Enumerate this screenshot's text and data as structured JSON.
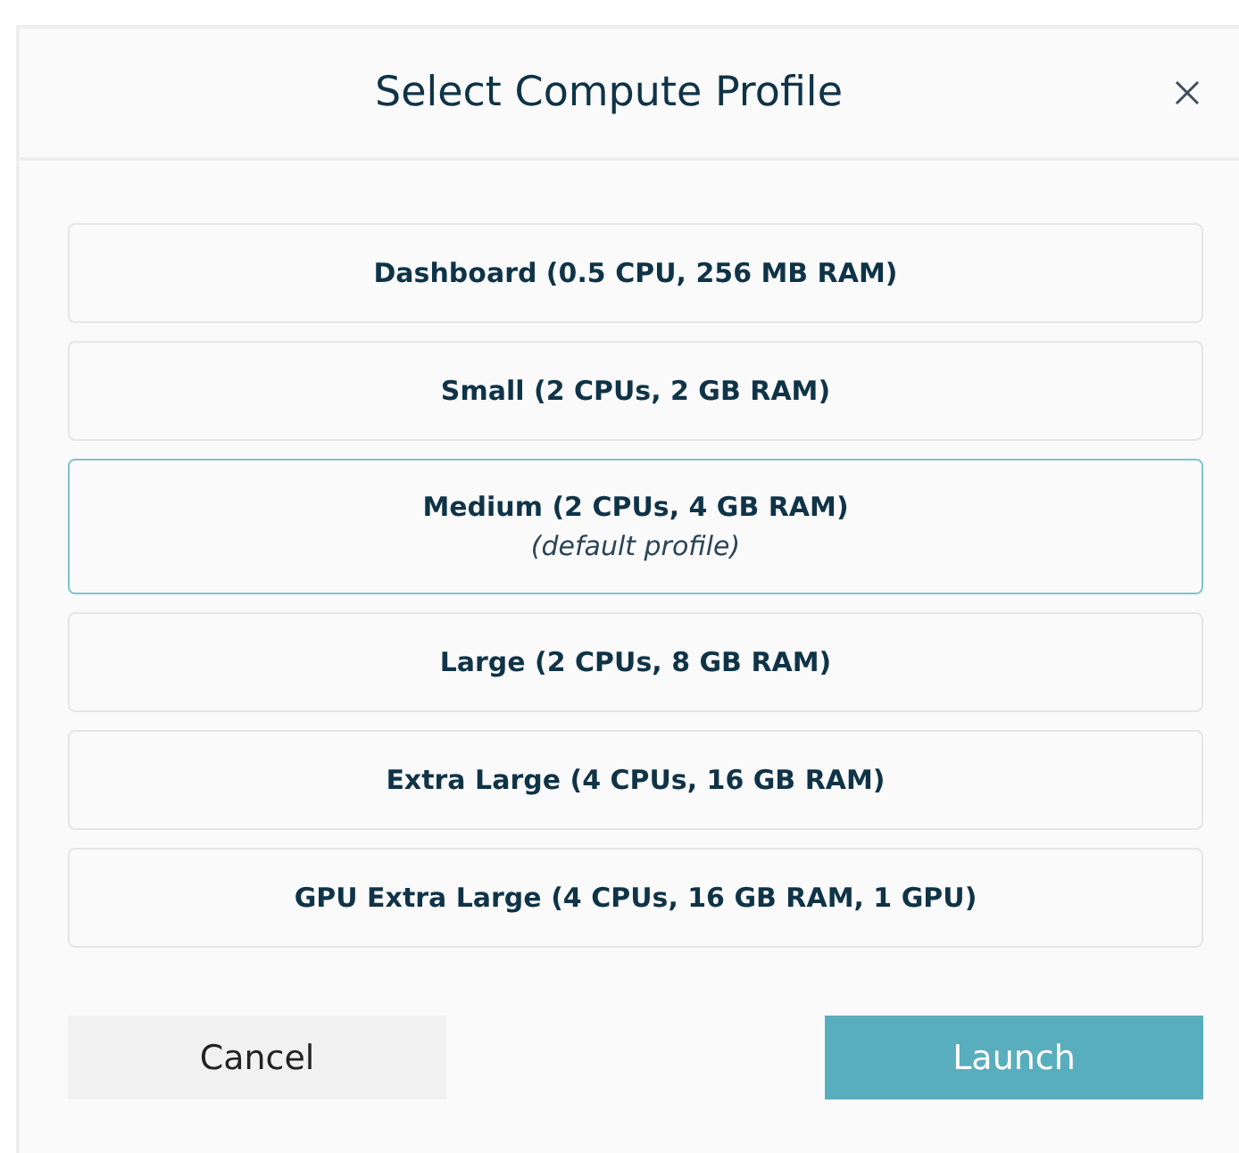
{
  "dialog": {
    "title": "Select Compute Profile"
  },
  "profiles": [
    {
      "label": "Dashboard (0.5 CPU, 256 MB RAM)",
      "selected": false
    },
    {
      "label": "Small (2 CPUs, 2 GB RAM)",
      "selected": false
    },
    {
      "label": "Medium (2 CPUs, 4 GB RAM)",
      "note": "(default profile)",
      "selected": true
    },
    {
      "label": "Large (2 CPUs, 8 GB RAM)",
      "selected": false
    },
    {
      "label": "Extra Large (4 CPUs, 16 GB RAM)",
      "selected": false
    },
    {
      "label": "GPU Extra Large (4 CPUs, 16 GB RAM, 1 GPU)",
      "selected": false
    }
  ],
  "buttons": [
    {
      "label": "Cancel",
      "kind": "secondary"
    },
    {
      "label": "Launch",
      "kind": "primary"
    }
  ]
}
